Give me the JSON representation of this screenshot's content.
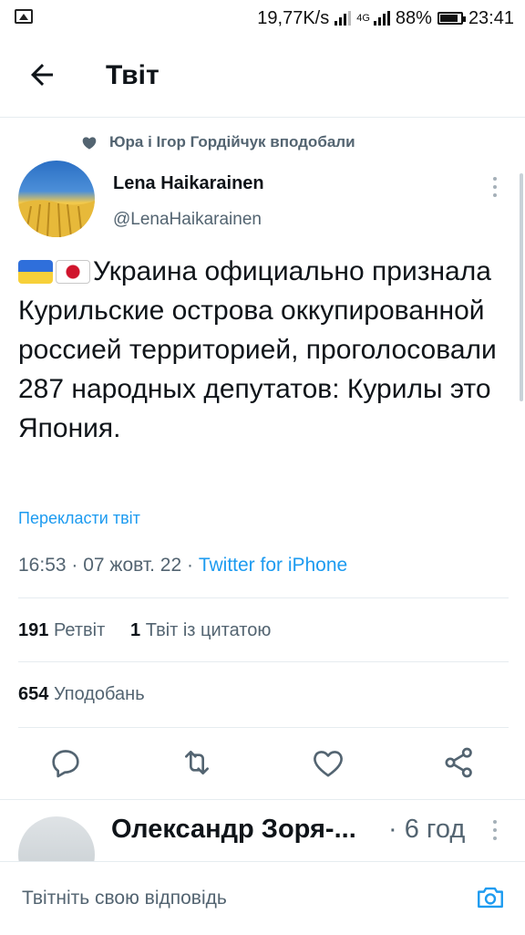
{
  "status_bar": {
    "net_speed": "19,77K/s",
    "network_type": "4G",
    "battery": "88%",
    "time": "23:41"
  },
  "header": {
    "title": "Твіт"
  },
  "tweet": {
    "social_context": "Юра і Ігор Гордійчук вподобали",
    "author_name": "Lena Haikarainen",
    "author_handle": "@LenaHaikarainen",
    "flags": [
      "ukraine-flag",
      "japan-flag"
    ],
    "text": "Украина официально признала Курильские острова оккупированной россией территорией, проголосовали 287 народных депутатов: Курилы это Япония.",
    "translate_label": "Перекласти твіт",
    "timestamp": "16:53 · 07 жовт. 22 · ",
    "source": "Twitter for iPhone",
    "retweets_count": "191",
    "retweets_label": "Ретвіт",
    "quotes_count": "1",
    "quotes_label": "Твіт із цитатою",
    "likes_count": "654",
    "likes_label": "Уподобань"
  },
  "reply": {
    "author_name": "Олександр Зоря-...",
    "time": "· 6 год"
  },
  "compose": {
    "placeholder": "Твітніть свою відповідь"
  },
  "colors": {
    "accent": "#1d9bf0",
    "secondary_text": "#536471"
  }
}
